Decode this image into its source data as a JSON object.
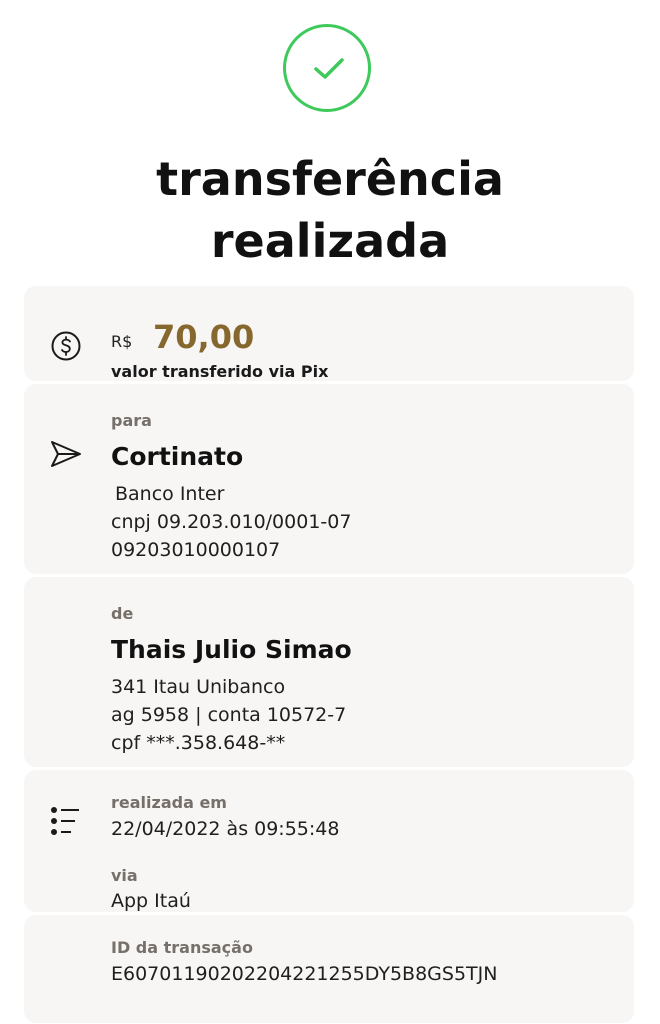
{
  "header": {
    "title_line1": "transferência",
    "title_line2": "realizada"
  },
  "amount": {
    "currency": "R$",
    "value": "70,00",
    "subtitle": "valor transferido via Pix"
  },
  "recipient": {
    "label": "para",
    "name": "Cortinato",
    "bank": "Banco Inter",
    "document": "cnpj 09.203.010/0001-07",
    "number": "09203010000107"
  },
  "sender": {
    "label": "de",
    "name": "Thais Julio Simao",
    "bank": "341 Itau Unibanco",
    "account": "ag 5958 | conta 10572-7",
    "document": "cpf ***.358.648-**"
  },
  "details": {
    "date_label": "realizada em",
    "date_value": "22/04/2022 às 09:55:48",
    "via_label": "via",
    "via_value": "App Itaú",
    "id_label": "ID da transação",
    "id_value": "E60701190202204221255DY5B8GS5TJN"
  },
  "colors": {
    "success": "#3ec95b",
    "amount": "#86682e"
  },
  "icons": {
    "status": "check-icon",
    "amount": "dollar-coin-icon",
    "recipient": "send-icon",
    "details": "list-icon"
  }
}
